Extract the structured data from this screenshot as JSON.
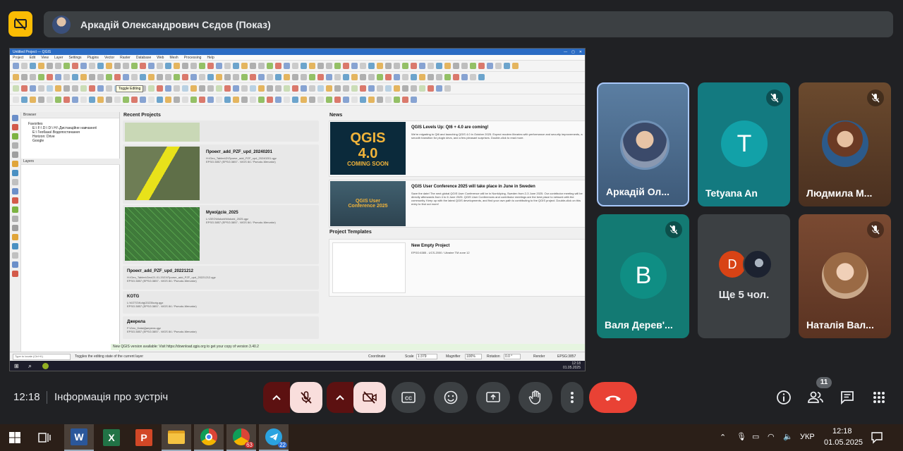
{
  "presenter": {
    "name": "Аркадій Олександрович Сєдов (Показ)"
  },
  "qgis": {
    "window_title": "Untitled Project — QGIS",
    "menu": [
      "Project",
      "Edit",
      "View",
      "Layer",
      "Settings",
      "Plugins",
      "Vector",
      "Raster",
      "Database",
      "Web",
      "Mesh",
      "Processing",
      "Help"
    ],
    "tooltip": "Toggle Editing",
    "browser_title": "Browser",
    "browser_items": [
      "Favorites",
      "E:\\ F:\\ D:\\ D:\\ Н:\\ Дистанційне навчання\\",
      "E:\\ Геобаза\\ Водопостачання",
      "Horizon: Drive",
      "Google"
    ],
    "layers_title": "Layers",
    "recent_title": "Recent Projects",
    "news_title": "News",
    "templates_title": "Project Templates",
    "recent_projects": [
      {
        "title": "Проект_add_PZF_upd_20240201",
        "path": "H:\\Geo_Tables\\D\\Проект_add_PZF_upd_20240201.qgz",
        "crs": "EPSG:3857 (EPSG:3857 - WGS 84 / Pseudo-Mercator)"
      },
      {
        "title": "Мукоїдсів_2025",
        "path": "L:\\GEO\\Mukoid\\Mukoid_2025.qgz",
        "crs": "EPSG:3857 (EPSG:3857 - WGS 84 / Pseudo-Mercator)"
      },
      {
        "title": "Проект_add_PZF_upd_20221212",
        "path": "H:\\Geo_Tables\\Geo\\21.01.2021\\Проект_add_PZF_upd_20221212.qgz",
        "crs": "EPSG:3857 (EPSG:3857 - WGS 84 / Pseudo-Mercator)"
      },
      {
        "title": "KOTG",
        "path": "L:\\KOTG\\Kotg\\2023\\kotg.qgz",
        "crs": "EPSG:3857 (EPSG:3857 - WGS 84 / Pseudo-Mercator)"
      },
      {
        "title": "Джерела",
        "path": "F:\\Geo_Data\\Джерела.qgz",
        "crs": "EPSG:3857 (EPSG:3857 - WGS 84 / Pseudo-Mercator)"
      }
    ],
    "news": [
      {
        "title": "QGIS Levels Up: Qt6 + 4.0 are coming!",
        "body": "We're migrating to Qt6 and launching QGIS 4.0 in October 2025. Expect modern libraries with performance and security improvements, a smooth transition for plugin devs, and a few pleasant surprises. Double-click to read more.",
        "img_line1": "QGIS",
        "img_line2": "4.0",
        "img_line3": "COMING SOON"
      },
      {
        "title": "QGIS User Conference 2025 will take place in June in Sweden",
        "body": "Save the date! The next global QGIS User Conference will be in Norrköping, Sweden from 2-3 June 2025. Our contributor meeting will be directly afterwards from 4 to 6 June 2025. QGIS User Conferences and contributor meetings are the best place to network with the community. Keep up with the latest QGIS developments, and find your own path to contributing to the QGIS project. Double-click on this entry to find out more!",
        "img_line1": "QGIS User",
        "img_line2": "Conference 2025"
      }
    ],
    "template": {
      "title": "New Empty Project",
      "crs": "EPSG:6385 - UCS-2000 / Ukraine TM zone 12"
    },
    "new_version_text": "New QGIS version available: Visit https://download.qgis.org to get your copy of version 3.40.2",
    "locate_placeholder": "Type to locate (Ctrl+K)",
    "status_hint": "Toggles the editing state of the current layer",
    "coordinate_label": "Coordinate",
    "scale_label": "Scale",
    "scale_value": "1:379",
    "magnifier_label": "Magnifier",
    "magnifier_value": "100%",
    "rotation_label": "Rotation",
    "rotation_value": "0.0 °",
    "render_label": "Render",
    "epsg_label": "EPSG:3857",
    "inner_time": "12:18",
    "inner_date": "01.05.2025"
  },
  "participants": [
    {
      "name": "Аркадій Ол...",
      "type": "photo",
      "muted": false,
      "highlight": true,
      "bg": "#4c6e8f"
    },
    {
      "name": "Tetyana An",
      "type": "letter",
      "letter": "T",
      "muted": true,
      "bg": "#137a80",
      "avatar_color": "#12a1a8"
    },
    {
      "name": "Людмила М...",
      "type": "photo",
      "muted": true,
      "bg": "#5b3b24"
    },
    {
      "name": "Валя Дерев'...",
      "type": "letter",
      "letter": "B",
      "muted": true,
      "bg": "#137a73",
      "avatar_color": "#0f8e84"
    },
    {
      "name": "Ще 5 чол.",
      "type": "more",
      "letter": "D",
      "bg": "#3c4043",
      "avatar_color": "#d84315"
    },
    {
      "name": "Наталія Вал...",
      "type": "photo",
      "muted": true,
      "bg": "#6b3f2a"
    }
  ],
  "bottom_bar": {
    "time": "12:18",
    "meeting_info": "Інформація про зустріч",
    "participants_count": "11"
  },
  "taskbar": {
    "chrome_badge": "63",
    "telegram_badge": "22",
    "lang": "УКР",
    "clock_time": "12:18",
    "clock_date": "01.05.2025"
  },
  "colors": {
    "accent_yellow": "#fbbc04",
    "hangup_red": "#e94235",
    "muted_control_bg": "#f9dedc",
    "muted_control_arrow": "#5c1111"
  }
}
